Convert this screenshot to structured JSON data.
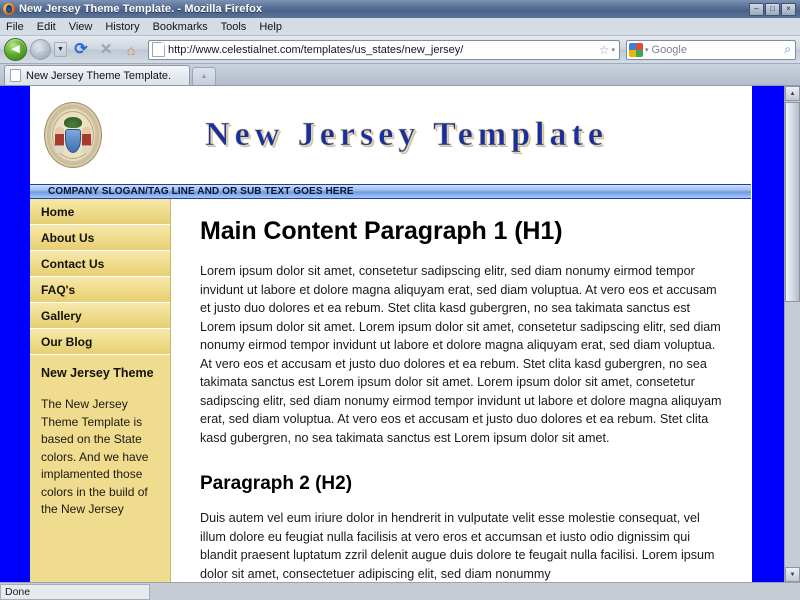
{
  "window": {
    "title": "New Jersey Theme Template. - Mozilla Firefox",
    "icon": "firefox-icon",
    "minimize_label": "–",
    "restore_label": "□",
    "close_label": "×"
  },
  "menubar": {
    "items": [
      "File",
      "Edit",
      "View",
      "History",
      "Bookmarks",
      "Tools",
      "Help"
    ]
  },
  "toolbar": {
    "back_icon": "◀",
    "forward_icon": "▶",
    "dropdown_icon": "▼",
    "reload_icon": "⟳",
    "stop_icon": "✕",
    "home_icon": "⌂",
    "url": "http://www.celestialnet.com/templates/us_states/new_jersey/",
    "star_icon": "☆",
    "caret_icon": "▾",
    "search_placeholder": "Google",
    "search_icon": "⌕",
    "google_colors": [
      "#3b7ddd",
      "#dd4b39",
      "#f2b600",
      "#3aa757"
    ]
  },
  "tabs": {
    "items": [
      {
        "label": "New Jersey Theme Template.",
        "favicon": "page-icon"
      }
    ],
    "new_tab_icon": "▲"
  },
  "page": {
    "background_color": "#0000ff",
    "header": {
      "logo_alt": "new-jersey-state-seal",
      "site_title": "New Jersey Template",
      "title_color": "#1a2f9e"
    },
    "slogan": "COMPANY SLOGAN/TAG LINE AND OR SUB TEXT GOES HERE",
    "sidebar": {
      "nav_items": [
        "Home",
        "About Us",
        "Contact Us",
        "FAQ's",
        "Gallery",
        "Our Blog"
      ],
      "panel_heading": "New Jersey Theme",
      "panel_text": "The New Jersey Theme Template is based on the State colors. And we have implamented those colors in the build of the New Jersey",
      "background_color": "#f0dc8e"
    },
    "main": {
      "h1": "Main Content Paragraph 1 (H1)",
      "paragraph1": "Lorem ipsum dolor sit amet, consetetur sadipscing elitr, sed diam nonumy eirmod tempor invidunt ut labore et dolore magna aliquyam erat, sed diam voluptua. At vero eos et accusam et justo duo dolores et ea rebum. Stet clita kasd gubergren, no sea takimata sanctus est Lorem ipsum dolor sit amet. Lorem ipsum dolor sit amet, consetetur sadipscing elitr, sed diam nonumy eirmod tempor invidunt ut labore et dolore magna aliquyam erat, sed diam voluptua. At vero eos et accusam et justo duo dolores et ea rebum. Stet clita kasd gubergren, no sea takimata sanctus est Lorem ipsum dolor sit amet. Lorem ipsum dolor sit amet, consetetur sadipscing elitr, sed diam nonumy eirmod tempor invidunt ut labore et dolore magna aliquyam erat, sed diam voluptua. At vero eos et accusam et justo duo dolores et ea rebum. Stet clita kasd gubergren, no sea takimata sanctus est Lorem ipsum dolor sit amet.",
      "h2": "Paragraph 2 (H2)",
      "paragraph2": "Duis autem vel eum iriure dolor in hendrerit in vulputate velit esse molestie consequat, vel illum dolore eu feugiat nulla facilisis at vero eros et accumsan et iusto odio dignissim qui blandit praesent luptatum zzril delenit augue duis dolore te feugait nulla facilisi. Lorem ipsum dolor sit amet, consectetuer adipiscing elit, sed diam nonummy"
    }
  },
  "scrollbar": {
    "up_icon": "▲",
    "down_icon": "▼"
  },
  "statusbar": {
    "text": "Done"
  }
}
